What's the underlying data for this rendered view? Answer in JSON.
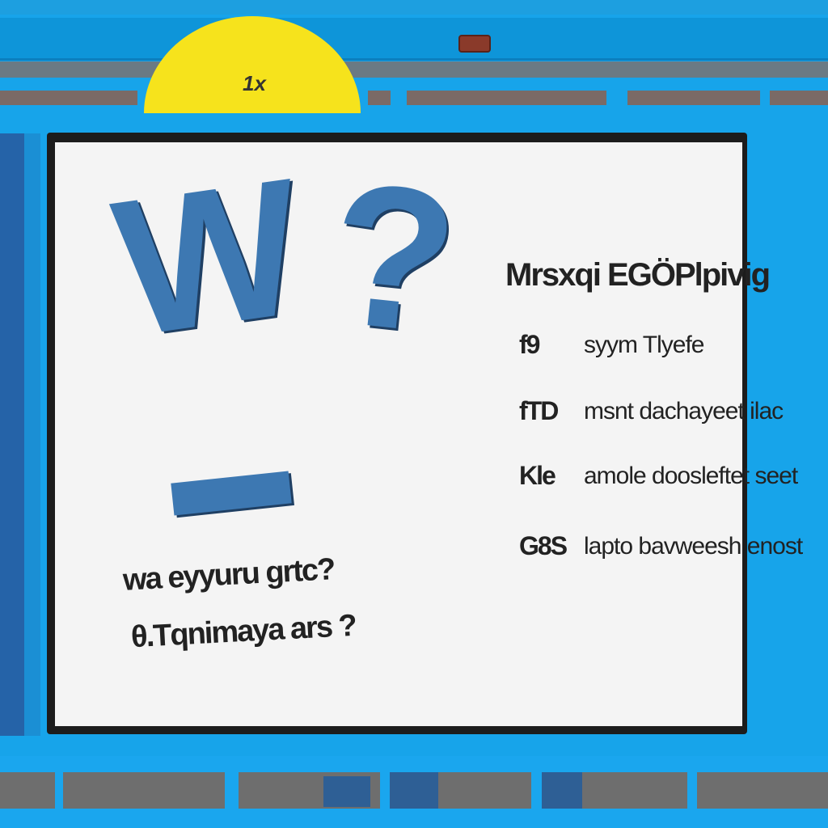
{
  "badge": {
    "label": "1x",
    "color": "#f6e31c"
  },
  "colors": {
    "frame": "#17a4ea",
    "accent": "#3d78b2",
    "panel": "#f4f4f4"
  },
  "panel": {
    "glyph_left": "W",
    "glyph_right": "?",
    "question_lines": [
      "wa eyyuru grtc?",
      "θ.Tqnimaya ars ?"
    ],
    "heading": "Mrsxqi EGÖPlpivig",
    "rows": [
      {
        "key": "f9",
        "value": "syym Tlyefe"
      },
      {
        "key": "fTD",
        "value": "msnt dachayeet ilac"
      },
      {
        "key": "Kle",
        "value": "amole doosleftet seet"
      },
      {
        "key": "G8S",
        "value": "lapto bavweesh enost"
      }
    ]
  }
}
